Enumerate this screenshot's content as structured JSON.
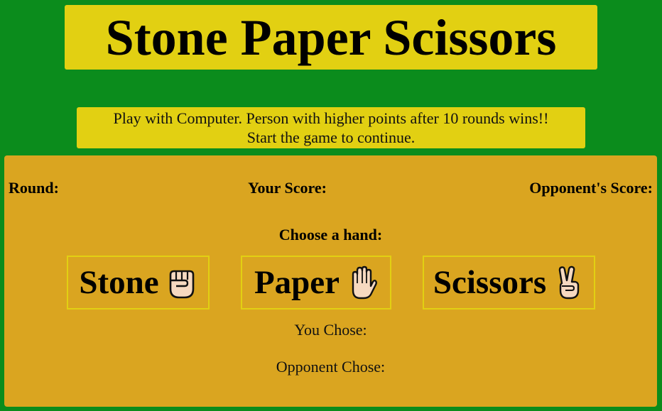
{
  "header": {
    "title": "Stone Paper Scissors"
  },
  "info": {
    "line1": "Play with Computer. Person with higher points after 10 rounds wins!!",
    "line2": "Start the game to continue."
  },
  "scoreboard": {
    "round_label": "Round:",
    "your_score_label": "Your Score:",
    "opponent_score_label": "Opponent's Score:"
  },
  "choose_label": "Choose a hand:",
  "hands": [
    {
      "label": "Stone",
      "icon": "fist-icon"
    },
    {
      "label": "Paper",
      "icon": "raised-hand-icon"
    },
    {
      "label": "Scissors",
      "icon": "victory-hand-icon"
    }
  ],
  "result": {
    "you_chose_label": "You Chose:",
    "opponent_chose_label": "Opponent Chose:"
  },
  "colors": {
    "background": "#0b8c1c",
    "title_box": "#e2d012",
    "panel": "#daa520",
    "skin": "#f6d9c0"
  }
}
